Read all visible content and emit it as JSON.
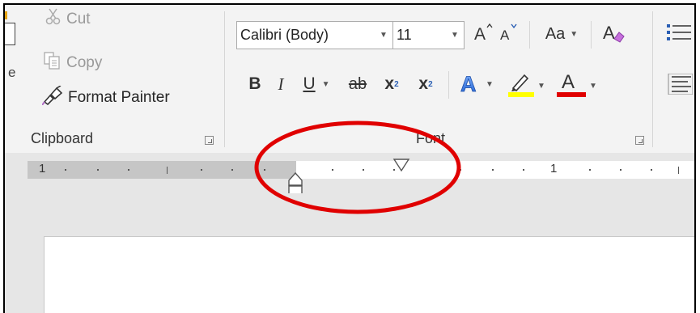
{
  "clipboard": {
    "cut_label": "Cut",
    "copy_label": "Copy",
    "format_painter_label": "Format Painter",
    "group_label": "Clipboard",
    "paste_fragment": "e"
  },
  "font": {
    "font_name": "Calibri (Body)",
    "font_size": "11",
    "change_case_label": "Aa",
    "group_label": "Font",
    "bold": "B",
    "italic": "I",
    "underline": "U",
    "strike": "ab",
    "subscript": "x",
    "superscript": "x"
  },
  "ruler": {
    "left_number": "1",
    "right_number": "1"
  },
  "colors": {
    "highlight": "#ffff00",
    "font_color": "#e00000",
    "annotation": "#e00000"
  }
}
